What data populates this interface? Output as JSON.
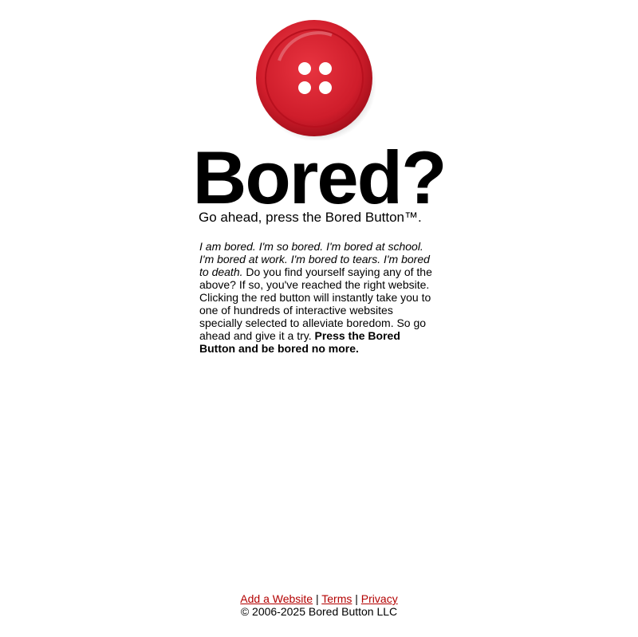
{
  "header": {
    "headline": "Bored?",
    "tagline": "Go ahead, press the Bored Button™."
  },
  "description": {
    "italic_intro": "I am bored. I'm so bored. I'm bored at school. I'm bored at work. I'm bored to tears. I'm bored to death.",
    "body": " Do you find yourself saying any of the above? If so, you've reached the right website. Clicking the red button will instantly take you to one of hundreds of interactive websites specially selected to alleviate boredom. So go ahead and give it a try. ",
    "bold_cta": "Press the Bored Button and be bored no more."
  },
  "footer": {
    "links": [
      {
        "label": "Add a Website"
      },
      {
        "label": "Terms"
      },
      {
        "label": "Privacy"
      }
    ],
    "separator": "|",
    "copyright": "© 2006-2025 Bored Button LLC"
  },
  "colors": {
    "button_red": "#d8202e",
    "link_red": "#b30000"
  },
  "icons": {
    "button": "red-sewing-button-icon"
  }
}
